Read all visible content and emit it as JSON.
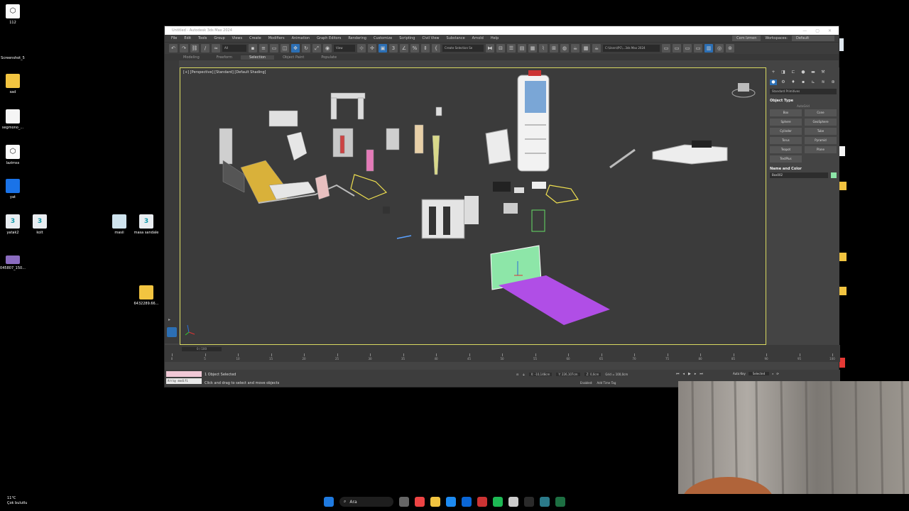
{
  "desktop_icons": [
    {
      "label": "112",
      "kind": "app"
    },
    {
      "label": "Screenshot_5",
      "kind": "doc"
    },
    {
      "label": "sad",
      "kind": "folder"
    },
    {
      "label": "segmono_...",
      "kind": "doc"
    },
    {
      "label": "lazimss",
      "kind": "app"
    },
    {
      "label": "yat",
      "kind": "shield"
    },
    {
      "label": "yatak2",
      "kind": "max"
    },
    {
      "label": "kolt",
      "kind": "max"
    },
    {
      "label": "masii",
      "kind": "img"
    },
    {
      "label": "masa sandale",
      "kind": "max"
    },
    {
      "label": "045807_150...",
      "kind": "img"
    },
    {
      "label": "6432289.66...",
      "kind": "folder"
    }
  ],
  "window": {
    "title": "Untitled - Autodesk 3ds Max 2024",
    "menu": [
      "File",
      "Edit",
      "Tools",
      "Group",
      "Views",
      "Create",
      "Modifiers",
      "Animation",
      "Graph Editors",
      "Rendering",
      "Customize",
      "Scripting",
      "Civil View",
      "Substance",
      "Arnold",
      "Help"
    ],
    "sign_in": "Cem Izmen",
    "workspaces_label": "Workspaces:",
    "workspaces_value": "Default",
    "toolbar_filter": "All",
    "toolbar_view": "View",
    "selection_set": "Create Selection Se",
    "project_path": "C:\\Users\\PC\\...3ds Max 2024",
    "ribbon_tabs": [
      "Modeling",
      "Freeform",
      "Selection",
      "Object Paint",
      "Populate"
    ],
    "ribbon_active": "Selection",
    "viewport_label": "[+] [Perspective] [Standard] [Default Shading]",
    "command_panel": {
      "dropdown": "Standard Primitives",
      "object_type_title": "Object Type",
      "autogrid": "AutoGrid",
      "buttons": [
        "Box",
        "Cone",
        "Sphere",
        "GeoSphere",
        "Cylinder",
        "Tube",
        "Torus",
        "Pyramid",
        "Teapot",
        "Plane",
        "TextPlus"
      ],
      "name_color_title": "Name and Color",
      "object_name": "Box002",
      "object_color": "#8de6a8"
    },
    "timeline": {
      "slider": "0 / 100",
      "ticks": [
        0,
        5,
        10,
        15,
        20,
        25,
        30,
        35,
        40,
        45,
        50,
        55,
        60,
        65,
        70,
        75,
        80,
        85,
        90,
        95,
        100
      ]
    },
    "status": {
      "script_text": "Array modifi",
      "selection": "1 Object Selected",
      "prompt": "Click and drag to select and move objects",
      "x": "X: -10,148cm",
      "y": "Y: 226,107cm",
      "z": "Z: 0,0cm",
      "grid": "Grid = 100,0cm",
      "enabled": "Enabled:",
      "add_time_tag": "Add Time Tag",
      "auto_key": "Auto Key",
      "selected": "Selected",
      "set_key": "Set Key"
    }
  },
  "taskbar": {
    "temperature": "11°C",
    "weather": "Çok bulutlu",
    "search": "Ara"
  }
}
